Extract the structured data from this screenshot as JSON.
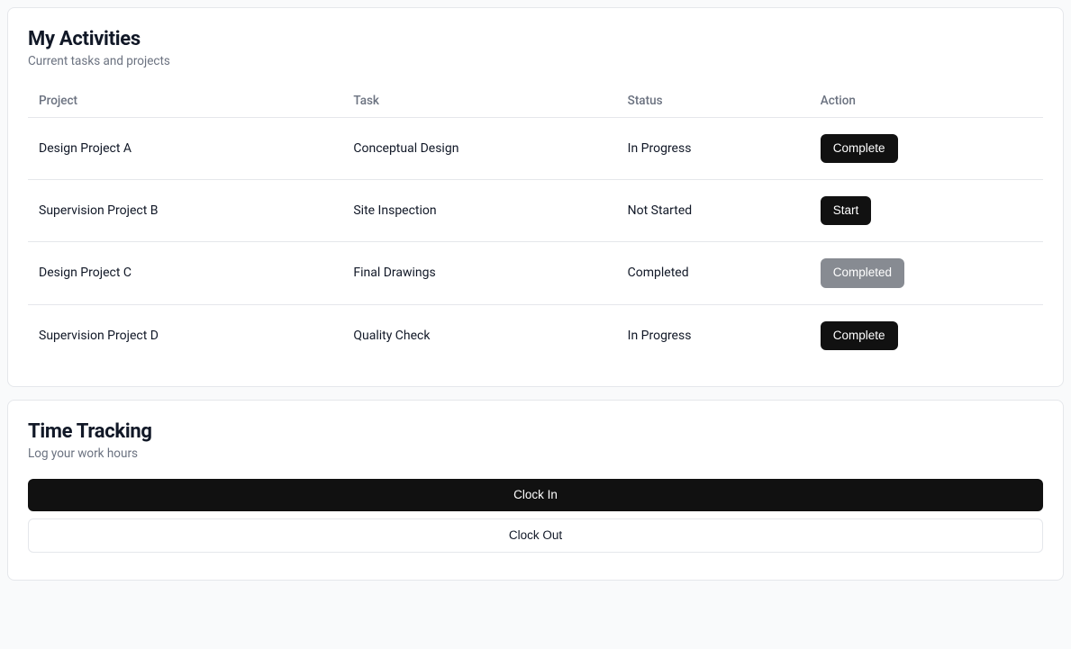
{
  "activities": {
    "title": "My Activities",
    "subtitle": "Current tasks and projects",
    "columns": {
      "project": "Project",
      "task": "Task",
      "status": "Status",
      "action": "Action"
    },
    "rows": [
      {
        "project": "Design Project A",
        "task": "Conceptual Design",
        "status": "In Progress",
        "action": "Complete",
        "action_variant": "dark"
      },
      {
        "project": "Supervision Project B",
        "task": "Site Inspection",
        "status": "Not Started",
        "action": "Start",
        "action_variant": "dark"
      },
      {
        "project": "Design Project C",
        "task": "Final Drawings",
        "status": "Completed",
        "action": "Completed",
        "action_variant": "secondary"
      },
      {
        "project": "Supervision Project D",
        "task": "Quality Check",
        "status": "In Progress",
        "action": "Complete",
        "action_variant": "dark"
      }
    ]
  },
  "time_tracking": {
    "title": "Time Tracking",
    "subtitle": "Log your work hours",
    "clock_in_label": "Clock In",
    "clock_out_label": "Clock Out"
  }
}
